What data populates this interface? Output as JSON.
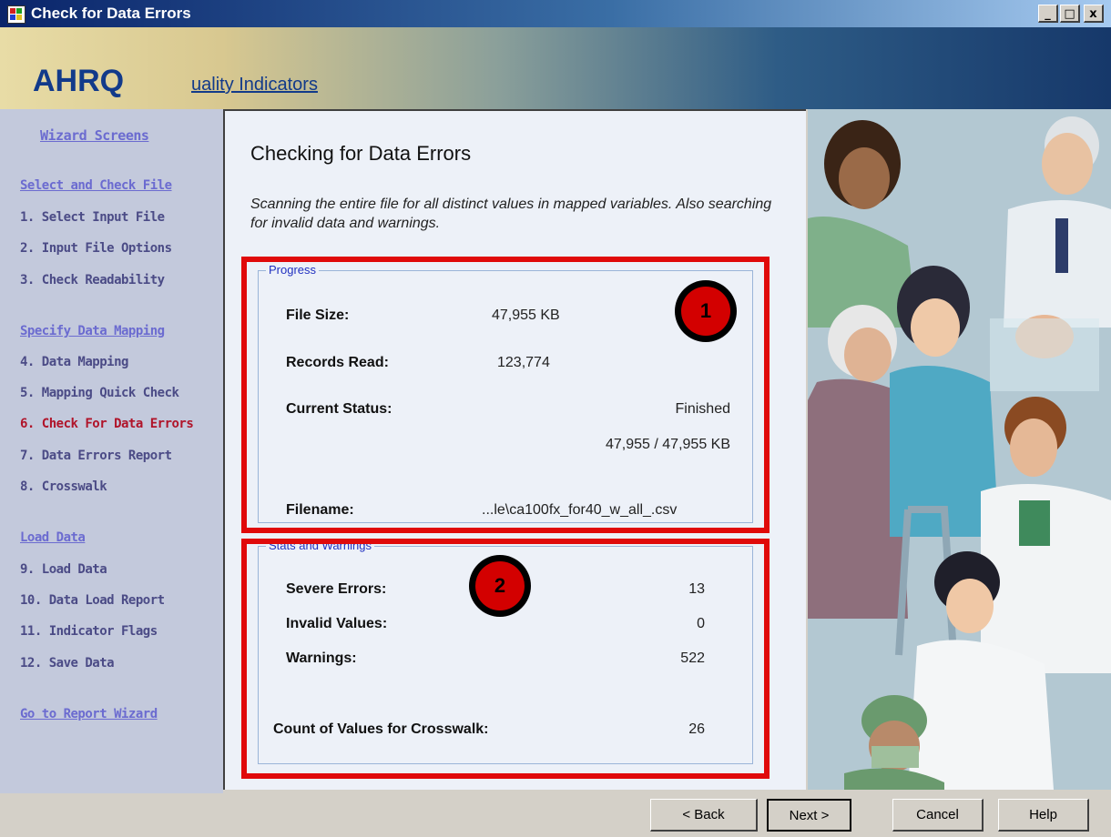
{
  "window": {
    "title": "Check for Data Errors",
    "controls": [
      "_",
      "□",
      "x"
    ]
  },
  "banner": {
    "logo_bold": "AHRQ",
    "logo_rest": "uality Indicators"
  },
  "sidebar": {
    "heading": "Wizard Screens",
    "items": [
      {
        "label": "Select and Check File",
        "type": "section"
      },
      {
        "label": "1. Select Input File",
        "type": "item"
      },
      {
        "label": "2. Input File Options",
        "type": "item"
      },
      {
        "label": "3. Check Readability",
        "type": "item"
      },
      {
        "label": "Specify Data Mapping",
        "type": "section"
      },
      {
        "label": "4. Data Mapping",
        "type": "item"
      },
      {
        "label": "5. Mapping Quick Check",
        "type": "item"
      },
      {
        "label": "6. Check For Data Errors",
        "type": "current"
      },
      {
        "label": "7. Data Errors Report",
        "type": "item"
      },
      {
        "label": "8. Crosswalk",
        "type": "item"
      },
      {
        "label": "Load Data",
        "type": "section"
      },
      {
        "label": "9. Load Data",
        "type": "item"
      },
      {
        "label": "10. Data Load Report",
        "type": "item"
      },
      {
        "label": "11. Indicator Flags",
        "type": "item"
      },
      {
        "label": "12. Save Data",
        "type": "item"
      },
      {
        "label": "Go to Report Wizard",
        "type": "section"
      }
    ]
  },
  "main": {
    "title": "Checking for Data Errors",
    "description": "Scanning the entire file for all distinct values in mapped variables.  Also searching for invalid data and warnings."
  },
  "progress": {
    "title": "Progress",
    "file_size_label": "File Size:",
    "file_size_value": "47,955 KB",
    "records_label": "Records Read:",
    "records_value": "123,774",
    "status_label": "Current Status:",
    "status_value": "Finished",
    "status_detail": "47,955 / 47,955 KB",
    "filename_label": "Filename:",
    "filename_value": "...le\\ca100fx_for40_w_all_.csv"
  },
  "stats": {
    "title": "Stats and Warnings",
    "severe_label": "Severe Errors:",
    "severe_value": "13",
    "invalid_label": "Invalid Values:",
    "invalid_value": "0",
    "warnings_label": "Warnings:",
    "warnings_value": "522",
    "crosswalk_label": "Count of Values for Crosswalk:",
    "crosswalk_value": "26"
  },
  "markers": {
    "one": "1",
    "two": "2"
  },
  "buttons": {
    "back": "< Back",
    "next": "Next >",
    "cancel": "Cancel",
    "help": "Help"
  },
  "colors": {
    "highlight_box": "#e00a0a",
    "current_step": "#b0142a",
    "group_title": "#2030c0"
  }
}
